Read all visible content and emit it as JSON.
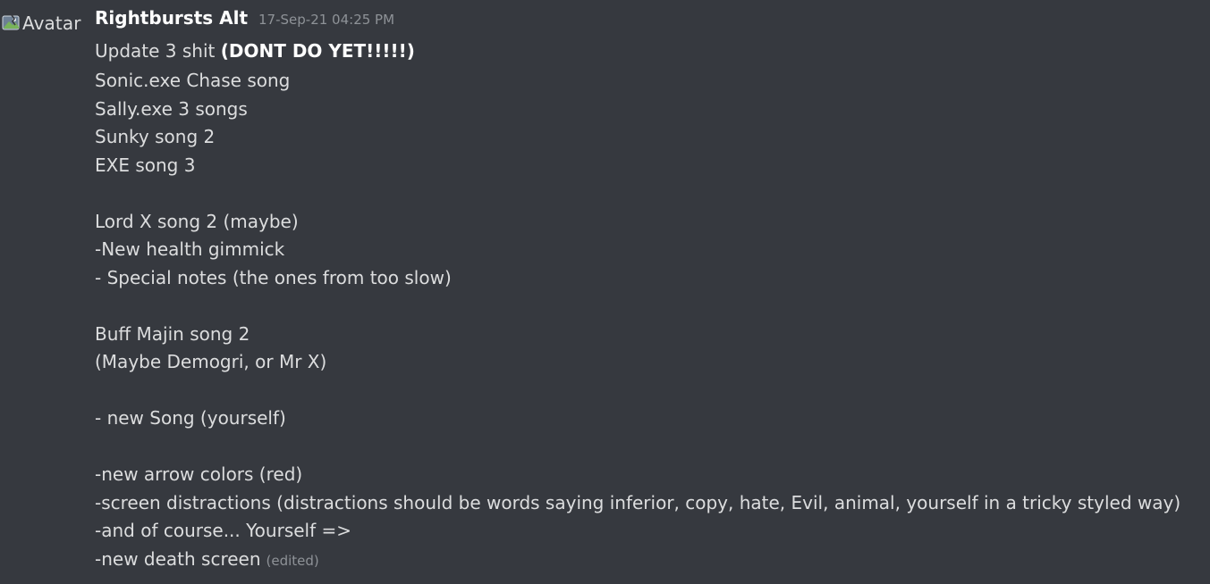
{
  "message": {
    "avatar_alt": "Avatar",
    "username": "Rightbursts Alt",
    "timestamp": "17-Sep-21 04:25 PM",
    "first_line": {
      "prefix": "Update 3 shit ",
      "bold": "(DONT DO YET!!!!!)"
    },
    "lines": [
      "Sonic.exe Chase song",
      "Sally.exe 3 songs",
      "Sunky song 2",
      "EXE song 3",
      "",
      "Lord X song 2 (maybe)",
      "-New health gimmick",
      "- Special notes (the ones from too slow)",
      "",
      "Buff Majin song 2",
      "(Maybe Demogri, or Mr X)",
      "",
      "- new Song (yourself)",
      "",
      "-new arrow colors (red)",
      "-screen distractions (distractions should be words saying inferior, copy, hate, Evil, animal, yourself in a tricky styled way)",
      "-and of course... Yourself =>",
      "-new death screen"
    ],
    "edited_label": "(edited)"
  }
}
